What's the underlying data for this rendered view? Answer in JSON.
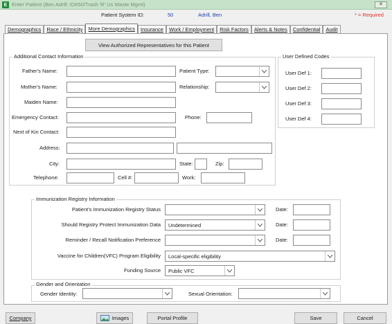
{
  "window": {
    "title": "Enter Patient (Ben Adrill: ID#50/Trash 'R' Us Waste Mgmt)",
    "close_glyph": "✕"
  },
  "header": {
    "system_id_label": "Patient System ID:",
    "system_id_value": "50",
    "patient_name": "Adrill, Ben",
    "required_note": "* = Required"
  },
  "tabs": [
    "Demographics",
    "Race / Ethnicity",
    "More Demographics",
    "Insurance",
    "Work / Employment",
    "Risk Factors",
    "Alerts & Notes",
    "Confidential",
    "Audit"
  ],
  "active_tab": "More Demographics",
  "view_reps_button": "View Authorized Representatives for this Patient",
  "contact": {
    "legend": "Additional Contact Information",
    "fathers_name": "Father's Name:",
    "mothers_name": "Mother's Name:",
    "maiden_name": "Maiden Name:",
    "emergency_contact": "Emergency Contact:",
    "next_of_kin": "Next of Kin Contact:",
    "address": "Address:",
    "city": "City:",
    "telephone": "Telephone:",
    "patient_type": "Patient Type:",
    "relationship": "Relationship:",
    "phone": "Phone:",
    "state": "State:",
    "zip": "Zip:",
    "cell": "Cell #:",
    "work": "Work:"
  },
  "user_defined": {
    "legend": "User Defined Codes",
    "labels": [
      "User Def 1:",
      "User Def 2:",
      "User Def 3:",
      "User Def 4:"
    ]
  },
  "immunization": {
    "legend": "Immunization Registry Information",
    "status_label": "Patient's Immunization Registry Status",
    "protect_label": "Should Registry Protect Immunization Data",
    "protect_value": "Undetermined",
    "reminder_label": "Reminder / Recall Notification Preference",
    "vfc_label": "Vaccine for Children(VFC) Program Eligibility",
    "vfc_value": "Local-specific eligibility",
    "funding_label": "Funding Source",
    "funding_value": "Public VFC",
    "date_label": "Date:"
  },
  "gender": {
    "legend": "Gender and Orientation",
    "identity_label": "Gender Identity:",
    "orientation_label": "Sexual Orientation:"
  },
  "bottom": {
    "company": "Company",
    "images": "Images",
    "portal": "Portal Profile",
    "save": "Save",
    "cancel": "Cancel"
  },
  "icons": {
    "app": "app-icon",
    "dropdown": "chevron-down-icon",
    "images": "image-icon"
  },
  "colors": {
    "title_bar": "#c6e3c9",
    "accent_blue": "#1a3fb0",
    "required_red": "#e0302a"
  }
}
